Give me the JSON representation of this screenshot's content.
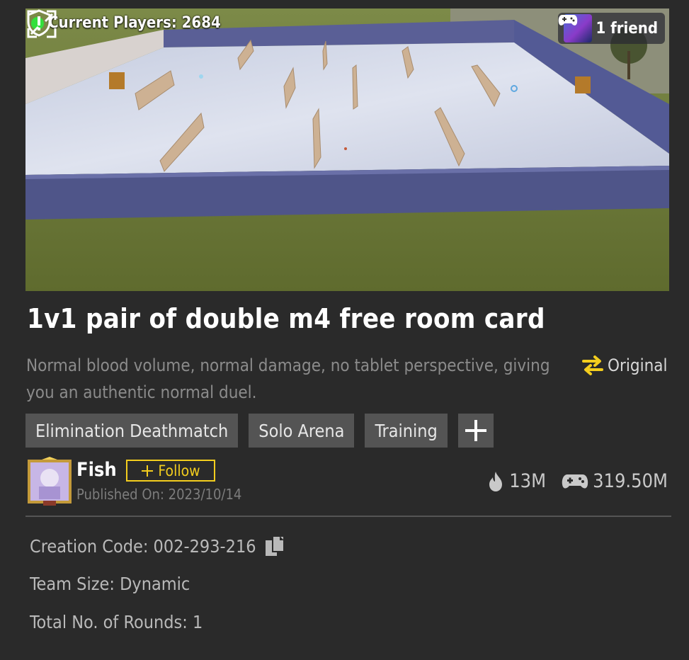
{
  "preview": {
    "current_players": "Current Players: 2684",
    "friend_label": "1 friend",
    "icons": {
      "status": "green-dot",
      "controller": "gamepad-icon",
      "report": "shield-icon",
      "expand": "expand-icon"
    }
  },
  "room": {
    "title": "1v1 pair of double m4 free room card",
    "description": "Normal blood volume, normal damage, no tablet perspective, giving you an authentic normal duel.",
    "original_label": "Original",
    "tags": [
      "Elimination Deathmatch",
      "Solo Arena",
      "Training"
    ]
  },
  "author": {
    "name": "Fish",
    "follow_label": "Follow",
    "published": "Published On: 2023/10/14"
  },
  "stats": {
    "popularity": "13M",
    "plays": "319.50M"
  },
  "details": {
    "creation_code": "Creation Code: 002-293-216",
    "team_size": "Team Size: Dynamic",
    "rounds": "Total No. of Rounds: 1"
  },
  "colors": {
    "accent": "#f3cd1e",
    "online": "#33e03c",
    "background": "#2a2a2a"
  }
}
